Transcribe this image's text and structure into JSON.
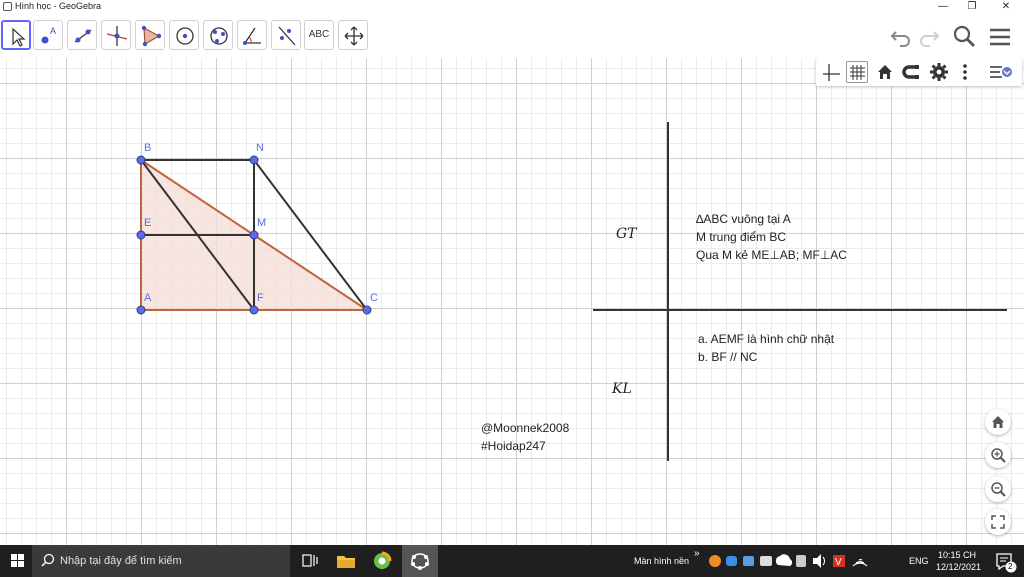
{
  "window": {
    "title": "Hình học - GeoGebra",
    "minimize": "—",
    "maximize": "❐",
    "close": "✕"
  },
  "toolbar": {
    "text_tool_label": "ABC"
  },
  "construction": {
    "points": [
      {
        "name": "B",
        "label": "B"
      },
      {
        "name": "N",
        "label": "N"
      },
      {
        "name": "E",
        "label": "E"
      },
      {
        "name": "M",
        "label": "M"
      },
      {
        "name": "A",
        "label": "A"
      },
      {
        "name": "F",
        "label": "F"
      },
      {
        "name": "C",
        "label": "C"
      }
    ],
    "fill_color": "#f3ddd4",
    "triangle_color": "#c0643a",
    "point_color": "#5a6ee0"
  },
  "notes": {
    "gt_label": "GT",
    "kl_label": "KL",
    "gt_lines": [
      "∆ABC vuông tại A",
      "M trung điểm BC",
      "Qua M kẻ ME⊥AB; MF⊥AC"
    ],
    "kl_lines": [
      "a. AEMF là hình chữ nhật",
      "b. BF // NC"
    ],
    "credit_lines": [
      "@Moonnek2008",
      "#Hoidap247"
    ]
  },
  "taskbar": {
    "search_placeholder": "Nhập tại đây để tìm kiếm",
    "desktop_label": "Màn hình nền",
    "language": "ENG",
    "time": "10:15 CH",
    "date": "12/12/2021",
    "notification_count": "2"
  }
}
